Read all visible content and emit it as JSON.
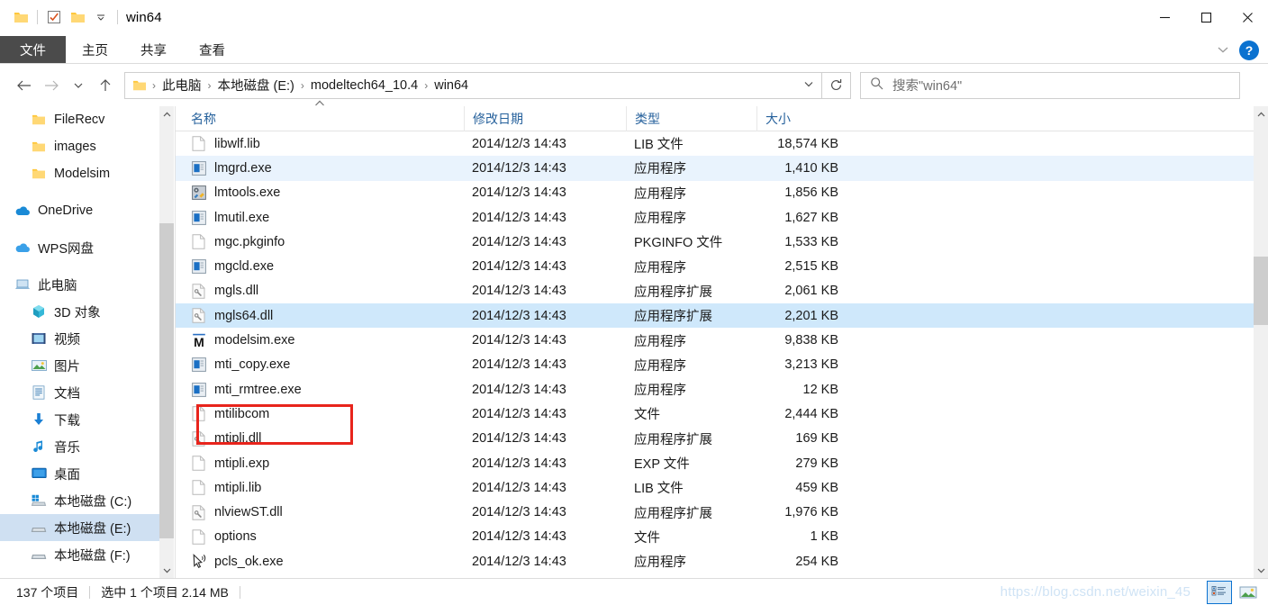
{
  "window": {
    "title": "win64",
    "quick_access": [
      "folder-icon",
      "checkbox-icon",
      "folder-icon",
      "dropdown-caret"
    ],
    "controls": {
      "minimize": "—",
      "maximize": "□",
      "close": "✕"
    }
  },
  "ribbon": {
    "file_tab": "文件",
    "tabs": [
      "主页",
      "共享",
      "查看"
    ],
    "collapse_caret": "⌄",
    "help": "?"
  },
  "address": {
    "back": "←",
    "forward": "→",
    "recent": "⌄",
    "up": "↑",
    "crumbs": [
      "此电脑",
      "本地磁盘 (E:)",
      "modeltech64_10.4",
      "win64"
    ],
    "separator": "›",
    "dropdown_caret": "⌄",
    "refresh": "↻"
  },
  "search": {
    "placeholder": "搜索\"win64\"",
    "icon": "search-icon"
  },
  "sidebar": {
    "groups": [
      {
        "items": [
          {
            "label": "FileRecv",
            "icon": "folder-icon",
            "indent": 1,
            "selected": false
          },
          {
            "label": "images",
            "icon": "folder-icon",
            "indent": 1,
            "selected": false
          },
          {
            "label": "Modelsim",
            "icon": "folder-icon",
            "indent": 1,
            "selected": false
          }
        ]
      },
      {
        "items": [
          {
            "label": "OneDrive",
            "icon": "cloud-icon",
            "indent": 0,
            "selected": false
          }
        ]
      },
      {
        "items": [
          {
            "label": "WPS网盘",
            "icon": "cloud-icon",
            "indent": 0,
            "selected": false
          }
        ]
      },
      {
        "items": [
          {
            "label": "此电脑",
            "icon": "computer-icon",
            "indent": 0,
            "selected": false
          },
          {
            "label": "3D 对象",
            "icon": "cube-icon",
            "indent": 1,
            "selected": false
          },
          {
            "label": "视频",
            "icon": "video-icon",
            "indent": 1,
            "selected": false
          },
          {
            "label": "图片",
            "icon": "pictures-icon",
            "indent": 1,
            "selected": false
          },
          {
            "label": "文档",
            "icon": "documents-icon",
            "indent": 1,
            "selected": false
          },
          {
            "label": "下载",
            "icon": "downloads-icon",
            "indent": 1,
            "selected": false
          },
          {
            "label": "音乐",
            "icon": "music-icon",
            "indent": 1,
            "selected": false
          },
          {
            "label": "桌面",
            "icon": "desktop-icon",
            "indent": 1,
            "selected": false
          },
          {
            "label": "本地磁盘 (C:)",
            "icon": "windows-drive-icon",
            "indent": 1,
            "selected": false
          },
          {
            "label": "本地磁盘 (E:)",
            "icon": "drive-icon",
            "indent": 1,
            "selected": true
          },
          {
            "label": "本地磁盘 (F:)",
            "icon": "drive-icon",
            "indent": 1,
            "selected": false
          }
        ]
      }
    ],
    "scroll_up": "⌃",
    "scroll_down": "⌄"
  },
  "filelist": {
    "columns": [
      {
        "label": "名称",
        "sorted": true,
        "sort_caret": "⌃"
      },
      {
        "label": "修改日期",
        "sorted": false
      },
      {
        "label": "类型",
        "sorted": false
      },
      {
        "label": "大小",
        "sorted": false
      }
    ],
    "rows": [
      {
        "name": "libwlf.lib",
        "date": "2014/12/3 14:43",
        "type": "LIB 文件",
        "size": "18,574 KB",
        "icon": "blank-file-icon",
        "state": ""
      },
      {
        "name": "lmgrd.exe",
        "date": "2014/12/3 14:43",
        "type": "应用程序",
        "size": "1,410 KB",
        "icon": "app-icon",
        "state": "hover"
      },
      {
        "name": "lmtools.exe",
        "date": "2014/12/3 14:43",
        "type": "应用程序",
        "size": "1,856 KB",
        "icon": "tools-app-icon",
        "state": ""
      },
      {
        "name": "lmutil.exe",
        "date": "2014/12/3 14:43",
        "type": "应用程序",
        "size": "1,627 KB",
        "icon": "app-icon",
        "state": ""
      },
      {
        "name": "mgc.pkginfo",
        "date": "2014/12/3 14:43",
        "type": "PKGINFO 文件",
        "size": "1,533 KB",
        "icon": "blank-file-icon",
        "state": ""
      },
      {
        "name": "mgcld.exe",
        "date": "2014/12/3 14:43",
        "type": "应用程序",
        "size": "2,515 KB",
        "icon": "app-icon",
        "state": ""
      },
      {
        "name": "mgls.dll",
        "date": "2014/12/3 14:43",
        "type": "应用程序扩展",
        "size": "2,061 KB",
        "icon": "dll-icon",
        "state": ""
      },
      {
        "name": "mgls64.dll",
        "date": "2014/12/3 14:43",
        "type": "应用程序扩展",
        "size": "2,201 KB",
        "icon": "dll-icon",
        "state": "selected"
      },
      {
        "name": "modelsim.exe",
        "date": "2014/12/3 14:43",
        "type": "应用程序",
        "size": "9,838 KB",
        "icon": "modelsim-icon",
        "state": ""
      },
      {
        "name": "mti_copy.exe",
        "date": "2014/12/3 14:43",
        "type": "应用程序",
        "size": "3,213 KB",
        "icon": "app-icon",
        "state": ""
      },
      {
        "name": "mti_rmtree.exe",
        "date": "2014/12/3 14:43",
        "type": "应用程序",
        "size": "12 KB",
        "icon": "app-icon",
        "state": ""
      },
      {
        "name": "mtilibcom",
        "date": "2014/12/3 14:43",
        "type": "文件",
        "size": "2,444 KB",
        "icon": "blank-file-icon",
        "state": ""
      },
      {
        "name": "mtipli.dll",
        "date": "2014/12/3 14:43",
        "type": "应用程序扩展",
        "size": "169 KB",
        "icon": "dll-icon",
        "state": ""
      },
      {
        "name": "mtipli.exp",
        "date": "2014/12/3 14:43",
        "type": "EXP 文件",
        "size": "279 KB",
        "icon": "blank-file-icon",
        "state": ""
      },
      {
        "name": "mtipli.lib",
        "date": "2014/12/3 14:43",
        "type": "LIB 文件",
        "size": "459 KB",
        "icon": "blank-file-icon",
        "state": ""
      },
      {
        "name": "nlviewST.dll",
        "date": "2014/12/3 14:43",
        "type": "应用程序扩展",
        "size": "1,976 KB",
        "icon": "dll-icon",
        "state": ""
      },
      {
        "name": "options",
        "date": "2014/12/3 14:43",
        "type": "文件",
        "size": "1 KB",
        "icon": "blank-file-icon",
        "state": ""
      },
      {
        "name": "pcls_ok.exe",
        "date": "2014/12/3 14:43",
        "type": "应用程序",
        "size": "254 KB",
        "icon": "pcls-icon",
        "state": ""
      }
    ],
    "scroll_up": "⌃",
    "scroll_down": "⌄"
  },
  "statusbar": {
    "item_count": "137 个项目",
    "selection": "选中 1 个项目  2.14 MB",
    "watermark": "https://blog.csdn.net/weixin_45",
    "views": [
      {
        "name": "details-view-button",
        "active": true
      },
      {
        "name": "large-icons-view-button",
        "active": false
      }
    ]
  },
  "colors": {
    "accent": "#0b72d0",
    "selection": "#cfe8fb",
    "hover": "#e9f3fd",
    "annotation": "#e8241c",
    "header_text": "#26619c",
    "folder": "#ffd04b"
  }
}
